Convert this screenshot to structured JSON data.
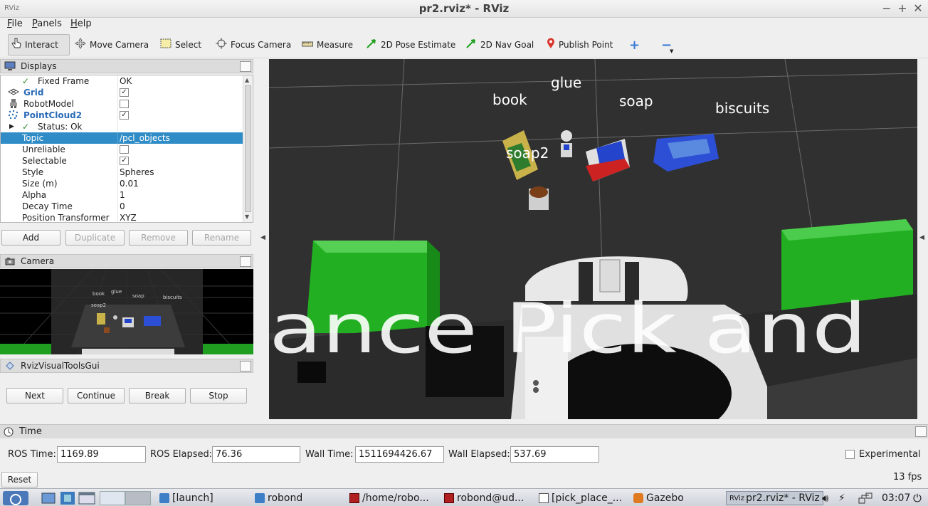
{
  "window": {
    "title": "pr2.rviz* - RViz",
    "controls": [
      "−",
      "+",
      "✕"
    ]
  },
  "menu": [
    "File",
    "Panels",
    "Help"
  ],
  "toolbar": {
    "interact": "Interact",
    "move_camera": "Move Camera",
    "select": "Select",
    "focus_camera": "Focus Camera",
    "measure": "Measure",
    "pose_estimate": "2D Pose Estimate",
    "nav_goal": "2D Nav Goal",
    "publish_point": "Publish Point"
  },
  "displays": {
    "title": "Displays",
    "rows": [
      {
        "name": "Fixed Frame",
        "value": "OK"
      },
      {
        "name": "Grid",
        "value": "✓"
      },
      {
        "name": "RobotModel",
        "value": ""
      },
      {
        "name": "PointCloud2",
        "value": "✓"
      },
      {
        "name": "Status: Ok",
        "value": ""
      },
      {
        "name": "Topic",
        "value": "/pcl_objects"
      },
      {
        "name": "Unreliable",
        "value": ""
      },
      {
        "name": "Selectable",
        "value": "✓"
      },
      {
        "name": "Style",
        "value": "Spheres"
      },
      {
        "name": "Size (m)",
        "value": "0.01"
      },
      {
        "name": "Alpha",
        "value": "1"
      },
      {
        "name": "Decay Time",
        "value": "0"
      },
      {
        "name": "Position Transformer",
        "value": "XYZ"
      }
    ],
    "buttons": [
      "Add",
      "Duplicate",
      "Remove",
      "Rename"
    ]
  },
  "camera": {
    "title": "Camera",
    "labels": [
      "book",
      "glue",
      "soap",
      "biscuits",
      "soap2"
    ]
  },
  "visual_tools": {
    "title": "RvizVisualToolsGui",
    "buttons": [
      "Next",
      "Continue",
      "Break",
      "Stop"
    ]
  },
  "scene": {
    "labels": [
      "book",
      "glue",
      "soap",
      "biscuits",
      "soap2"
    ],
    "banner": "ance Pick and"
  },
  "time": {
    "title": "Time",
    "ros_time_label": "ROS Time:",
    "ros_time": "1169.89",
    "ros_elapsed_label": "ROS Elapsed:",
    "ros_elapsed": "76.36",
    "wall_time_label": "Wall Time:",
    "wall_time": "1511694426.67",
    "wall_elapsed_label": "Wall Elapsed:",
    "wall_elapsed": "537.69",
    "experimental": "Experimental",
    "reset": "Reset",
    "fps": "13 fps"
  },
  "taskbar": {
    "tasks": [
      "[launch]",
      "robond",
      "/home/robo...",
      "robond@ud...",
      "[pick_place_...",
      "Gazebo",
      "pr2.rviz* - RViz"
    ],
    "clock": "03:07"
  },
  "colors": {
    "selection": "#308cc6",
    "viewport_bg": "#303030",
    "object_green": "#22b022"
  }
}
